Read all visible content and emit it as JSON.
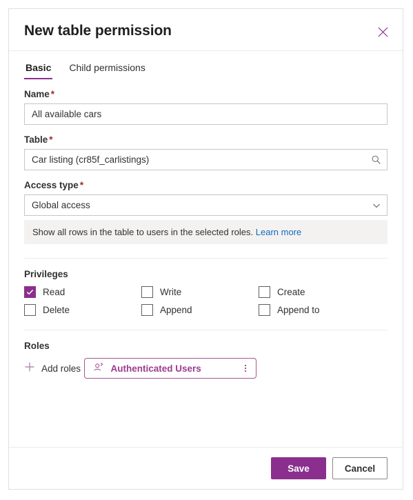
{
  "dialog": {
    "title": "New table permission",
    "close_icon": "close-icon"
  },
  "tabs": [
    {
      "label": "Basic",
      "active": true
    },
    {
      "label": "Child permissions",
      "active": false
    }
  ],
  "fields": {
    "name": {
      "label": "Name",
      "required_marker": "*",
      "value": "All available cars",
      "placeholder": "Name"
    },
    "table": {
      "label": "Table",
      "required_marker": "*",
      "value": "Car listing (cr85f_carlistings)",
      "placeholder": "Search tables",
      "icon": "search-icon"
    },
    "access_type": {
      "label": "Access type",
      "required_marker": "*",
      "value": "Global access",
      "icon": "chevron-down-icon",
      "info_text": "Show all rows in the table to users in the selected roles.",
      "info_link": "Learn more"
    }
  },
  "privileges": {
    "title": "Privileges",
    "items": [
      {
        "label": "Read",
        "checked": true
      },
      {
        "label": "Write",
        "checked": false
      },
      {
        "label": "Create",
        "checked": false
      },
      {
        "label": "Delete",
        "checked": false
      },
      {
        "label": "Append",
        "checked": false
      },
      {
        "label": "Append to",
        "checked": false
      }
    ]
  },
  "roles": {
    "title": "Roles",
    "add_label": "Add roles",
    "add_icon": "plus-icon",
    "chips": [
      {
        "label": "Authenticated Users",
        "icon": "user-role-icon",
        "more_icon": "more-vertical-icon"
      }
    ]
  },
  "footer": {
    "save_label": "Save",
    "cancel_label": "Cancel"
  },
  "colors": {
    "accent": "#8a2f8e",
    "chip_border": "#a8568f",
    "chip_text": "#9a3c8c",
    "link": "#0f6cbd",
    "required": "#a4262c",
    "banner_bg": "#f3f2f1"
  }
}
